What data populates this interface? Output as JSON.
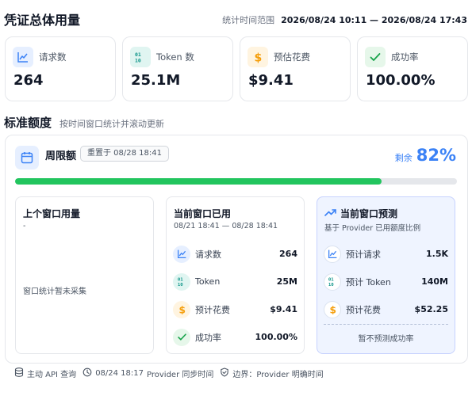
{
  "header": {
    "title": "凭证总体用量",
    "range_label": "统计时间范围",
    "range_value": "2026/08/24 10:11 — 2026/08/24 17:43"
  },
  "stats": [
    {
      "label": "请求数",
      "value": "264",
      "icon": "chart-line-icon"
    },
    {
      "label": "Token 数",
      "value": "25.1M",
      "icon": "binary-icon"
    },
    {
      "label": "预估花费",
      "value": "$9.41",
      "icon": "dollar-icon"
    },
    {
      "label": "成功率",
      "value": "100.00%",
      "icon": "check-icon"
    }
  ],
  "section": {
    "title": "标准额度",
    "subtitle": "按时间窗口统计并滚动更新"
  },
  "quota": {
    "title": "周限额",
    "reset": "重置于 08/28 18:41",
    "remain_label": "剩余",
    "remain_value": "82%",
    "used_fraction": 0.83,
    "panels": {
      "prev": {
        "title": "上个窗口用量",
        "sub": "-",
        "empty": "窗口统计暂未采集"
      },
      "current": {
        "title": "当前窗口已用",
        "sub": "08/21 18:41 — 08/28 18:41",
        "rows": [
          {
            "label": "请求数",
            "value": "264"
          },
          {
            "label": "Token",
            "value": "25M"
          },
          {
            "label": "预计花费",
            "value": "$9.41"
          },
          {
            "label": "成功率",
            "value": "100.00%"
          }
        ]
      },
      "forecast": {
        "title": "当前窗口预测",
        "sub": "基于 Provider 已用额度比例",
        "rows": [
          {
            "label": "预计请求",
            "value": "1.5K"
          },
          {
            "label": "预计 Token",
            "value": "140M"
          },
          {
            "label": "预计花费",
            "value": "$52.25"
          }
        ],
        "note": "暂不预测成功率"
      }
    }
  },
  "footer": {
    "source": "主动 API 查询",
    "time": "08/24 18:17",
    "sync": "Provider 同步时间",
    "boundary": "边界：Provider 明确时间"
  },
  "colors": {
    "accent": "#3b82f6",
    "progress": "#22c55e",
    "track": "#e5e7eb"
  }
}
